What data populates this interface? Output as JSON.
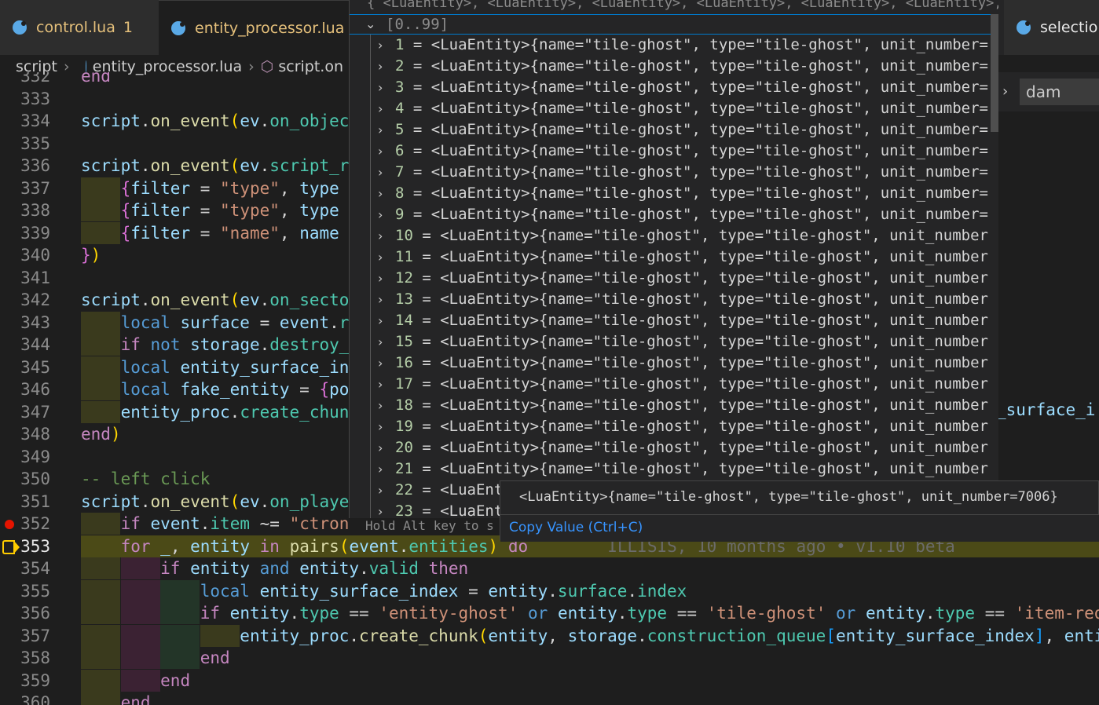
{
  "tabs": [
    {
      "label": "control.lua",
      "badge": "1"
    },
    {
      "label": "entity_processor.lua"
    },
    {
      "label": "selection_"
    }
  ],
  "breadcrumb": [
    "script",
    "entity_processor.lua",
    "script.on"
  ],
  "find": {
    "value": "dam"
  },
  "editor": {
    "lines": [
      {
        "n": "332",
        "t": "end"
      },
      {
        "n": "333",
        "t": ""
      },
      {
        "n": "334",
        "t": "script.on_event(ev.on_objec"
      },
      {
        "n": "335",
        "t": ""
      },
      {
        "n": "336",
        "t": "script.on_event(ev.script_r"
      },
      {
        "n": "337",
        "t": "    {filter = \"type\", type"
      },
      {
        "n": "338",
        "t": "    {filter = \"type\", type"
      },
      {
        "n": "339",
        "t": "    {filter = \"name\", name"
      },
      {
        "n": "340",
        "t": "})"
      },
      {
        "n": "341",
        "t": ""
      },
      {
        "n": "342",
        "t": "script.on_event(ev.on_secto"
      },
      {
        "n": "343",
        "t": "    local surface = event.r"
      },
      {
        "n": "344",
        "t": "    if not storage.destroy_"
      },
      {
        "n": "345",
        "t": "    local entity_surface_in"
      },
      {
        "n": "346",
        "t": "    local fake_entity = {po"
      },
      {
        "n": "347",
        "t": "    entity_proc.create_chun"
      },
      {
        "n": "348",
        "t": "end)"
      },
      {
        "n": "349",
        "t": ""
      },
      {
        "n": "350",
        "t": "-- left click"
      },
      {
        "n": "351",
        "t": "script.on_event(ev.on_playe"
      },
      {
        "n": "352",
        "t": "    if event.item ~= \"ctron"
      },
      {
        "n": "353",
        "t": "    for _, entity in pairs(event.entities) do"
      },
      {
        "n": "354",
        "t": "        if entity and entity.valid then"
      },
      {
        "n": "355",
        "t": "            local entity_surface_index = entity.surface.index"
      },
      {
        "n": "356",
        "t": "            if entity.type == 'entity-ghost' or entity.type == 'tile-ghost' or entity.type == 'item-req"
      },
      {
        "n": "357",
        "t": "                entity_proc.create_chunk(entity, storage.construction_queue[entity_surface_index], enti"
      },
      {
        "n": "358",
        "t": "            end"
      },
      {
        "n": "359",
        "t": "        end"
      },
      {
        "n": "360",
        "t": "    end"
      }
    ],
    "blame": "ILLISIS, 10 months ago • v1.10 beta",
    "right_fragment": "_surface_i"
  },
  "debug_hover": {
    "header": "{ <LuaEntity>, <LuaEntity>, <LuaEntity>, <LuaEntity>, <LuaEntity>, <LuaEntity>,…",
    "group": "[0..99]",
    "rows": [
      {
        "i": "1",
        "v": "<LuaEntity>{name=\"tile-ghost\", type=\"tile-ghost\", unit_number="
      },
      {
        "i": "2",
        "v": "<LuaEntity>{name=\"tile-ghost\", type=\"tile-ghost\", unit_number="
      },
      {
        "i": "3",
        "v": "<LuaEntity>{name=\"tile-ghost\", type=\"tile-ghost\", unit_number="
      },
      {
        "i": "4",
        "v": "<LuaEntity>{name=\"tile-ghost\", type=\"tile-ghost\", unit_number="
      },
      {
        "i": "5",
        "v": "<LuaEntity>{name=\"tile-ghost\", type=\"tile-ghost\", unit_number="
      },
      {
        "i": "6",
        "v": "<LuaEntity>{name=\"tile-ghost\", type=\"tile-ghost\", unit_number="
      },
      {
        "i": "7",
        "v": "<LuaEntity>{name=\"tile-ghost\", type=\"tile-ghost\", unit_number="
      },
      {
        "i": "8",
        "v": "<LuaEntity>{name=\"tile-ghost\", type=\"tile-ghost\", unit_number="
      },
      {
        "i": "9",
        "v": "<LuaEntity>{name=\"tile-ghost\", type=\"tile-ghost\", unit_number="
      },
      {
        "i": "10",
        "v": "<LuaEntity>{name=\"tile-ghost\", type=\"tile-ghost\", unit_number"
      },
      {
        "i": "11",
        "v": "<LuaEntity>{name=\"tile-ghost\", type=\"tile-ghost\", unit_number"
      },
      {
        "i": "12",
        "v": "<LuaEntity>{name=\"tile-ghost\", type=\"tile-ghost\", unit_number"
      },
      {
        "i": "13",
        "v": "<LuaEntity>{name=\"tile-ghost\", type=\"tile-ghost\", unit_number"
      },
      {
        "i": "14",
        "v": "<LuaEntity>{name=\"tile-ghost\", type=\"tile-ghost\", unit_number"
      },
      {
        "i": "15",
        "v": "<LuaEntity>{name=\"tile-ghost\", type=\"tile-ghost\", unit_number"
      },
      {
        "i": "16",
        "v": "<LuaEntity>{name=\"tile-ghost\", type=\"tile-ghost\", unit_number"
      },
      {
        "i": "17",
        "v": "<LuaEntity>{name=\"tile-ghost\", type=\"tile-ghost\", unit_number"
      },
      {
        "i": "18",
        "v": "<LuaEntity>{name=\"tile-ghost\", type=\"tile-ghost\", unit_number"
      },
      {
        "i": "19",
        "v": "<LuaEntity>{name=\"tile-ghost\", type=\"tile-ghost\", unit_number"
      },
      {
        "i": "20",
        "v": "<LuaEntity>{name=\"tile-ghost\", type=\"tile-ghost\", unit_number"
      },
      {
        "i": "21",
        "v": "<LuaEntity>{name=\"tile-ghost\", type=\"tile-ghost\", unit_number"
      },
      {
        "i": "22",
        "v": "<LuaEnt"
      },
      {
        "i": "23",
        "v": "<LuaEnt"
      }
    ],
    "hint": "Hold Alt key to s"
  },
  "tooltip": {
    "value": "<LuaEntity>{name=\"tile-ghost\", type=\"tile-ghost\", unit_number=7006}",
    "copy": "Copy Value (Ctrl+C)"
  },
  "colors": {
    "accent": "#007acc",
    "breakpoint": "#e51400",
    "current_line": "#4b4a17",
    "link": "#3794ff"
  }
}
